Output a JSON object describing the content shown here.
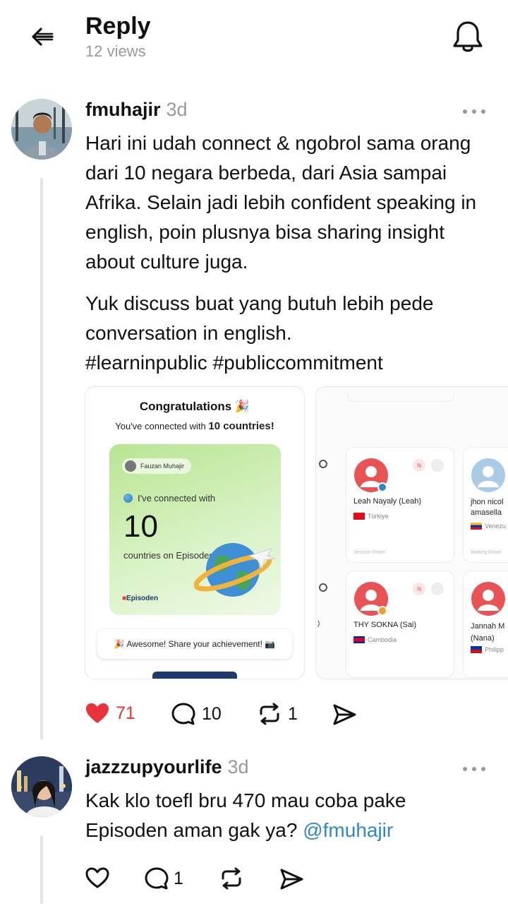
{
  "header": {
    "title": "Reply",
    "views": "12 views"
  },
  "post": {
    "username": "fmuhajir",
    "time": "3d",
    "paragraph1": "Hari ini udah connect & ngobrol sama orang dari 10 negara berbeda, dari Asia sampai Afrika. Selain jadi lebih confident speaking in english, poin plusnya bisa sharing insight about culture juga.",
    "paragraph2": "Yuk discuss buat yang butuh lebih pede conversation in english.",
    "hashtags": "#learninpublic #publiccommitment",
    "likes": "71",
    "comments": "10",
    "reposts": "1",
    "liked": true,
    "image1": {
      "title": "Congratulations 🎉",
      "subtitle_pre": "You've connected with ",
      "subtitle_bold": "10 countries!",
      "badge_name": "Fauzan Muhajir",
      "connected_text": "I've connected with",
      "big_number": "10",
      "countries_text": "countries on Episoden!",
      "brand": "Episoden",
      "share_button": "🎉 Awesome! Share your achievement! 📷"
    },
    "image2": {
      "people": [
        {
          "name": "Leah Nayaly (Leah)",
          "country": "Türkiye",
          "room": "Session Room",
          "n": "N"
        },
        {
          "name": "jhon nicol amasella",
          "country": "Venezu",
          "room": "Waiting Room"
        },
        {
          "name": "THY SOKNA (Sai)",
          "country": "Cambodia",
          "n": "N"
        },
        {
          "name": "Jannah M (Nana)",
          "country": "Philipp"
        }
      ]
    }
  },
  "reply": {
    "username": "jazzzupyourlife",
    "time": "3d",
    "text_pre": "Kak klo toefl bru 470 mau coba pake Episoden aman gak ya? ",
    "mention": "@fmuhajir",
    "comments": "1"
  },
  "colors": {
    "like_red": "#e8323c",
    "link_blue": "#2f86c8",
    "card_green": "#c8eca6",
    "brand_navy": "#1e3a6b"
  }
}
